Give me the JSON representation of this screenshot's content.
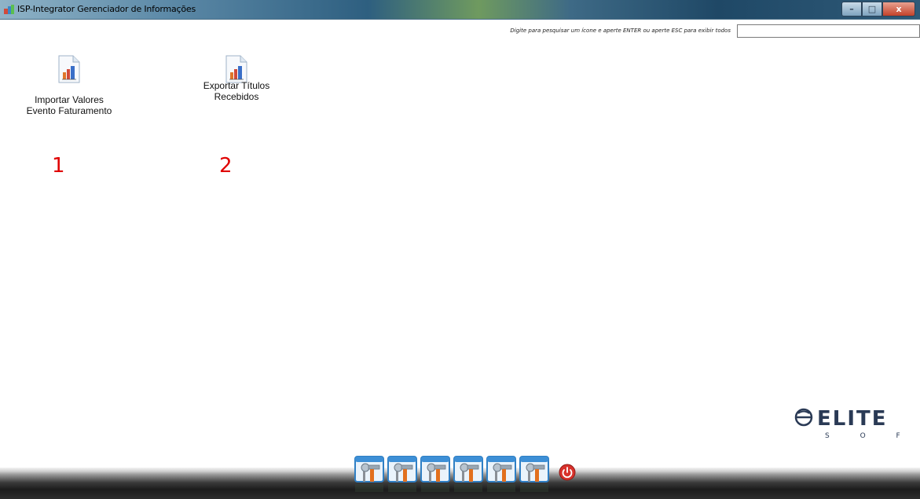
{
  "window": {
    "title": "ISP-Integrator Gerenciador de Informações",
    "buttons": {
      "minimize": "–",
      "maximize": "□",
      "close": "x"
    }
  },
  "search": {
    "hint": "Digite para pesquisar um ícone e aperte ENTER ou aperte ESC para exibir todos",
    "value": ""
  },
  "desktop": {
    "items": [
      {
        "label_line1": "Importar Valores",
        "label_line2": "Evento Faturamento",
        "icon": "report-chart-icon",
        "annotation": "1"
      },
      {
        "label_line1": "Exportar Títulos",
        "label_line2": "Recebidos",
        "icon": "report-chart-icon",
        "annotation": "2"
      }
    ]
  },
  "logo": {
    "main": "ELITE",
    "sub": "S O F T"
  },
  "dock": {
    "tools": [
      "tools-icon",
      "tools-icon",
      "tools-icon",
      "tools-icon",
      "tools-icon",
      "tools-icon"
    ],
    "power": "power-icon"
  },
  "colors": {
    "annotation": "#e00000",
    "accent": "#2e5f80"
  }
}
